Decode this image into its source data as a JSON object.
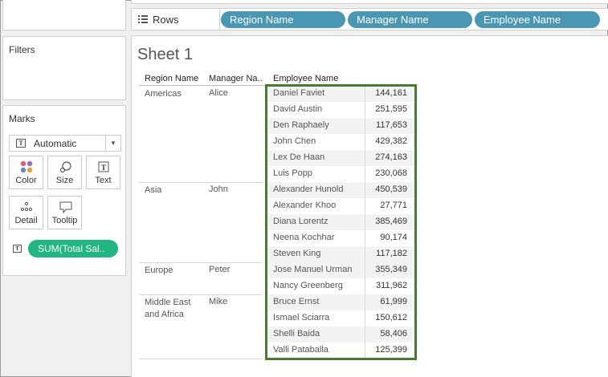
{
  "rows_shelf": {
    "label": "Rows",
    "pills": [
      "Region Name",
      "Manager Name",
      "Employee Name"
    ]
  },
  "filters": {
    "title": "Filters"
  },
  "marks": {
    "title": "Marks",
    "mark_type": "Automatic",
    "buttons": {
      "color": "Color",
      "size": "Size",
      "text": "Text",
      "detail": "Detail",
      "tooltip": "Tooltip"
    },
    "measure_pill": "SUM(Total Sal.."
  },
  "sheet": {
    "title": "Sheet 1",
    "headers": {
      "region": "Region Name",
      "manager": "Manager Na..",
      "employee": "Employee Name"
    },
    "groups": [
      {
        "region": "Americas",
        "manager": "Alice",
        "employees": [
          {
            "name": "Daniel Faviet",
            "value": "144,161"
          },
          {
            "name": "David Austin",
            "value": "251,595"
          },
          {
            "name": "Den Raphaely",
            "value": "117,653"
          },
          {
            "name": "John Chen",
            "value": "429,382"
          },
          {
            "name": "Lex De Haan",
            "value": "274,163"
          },
          {
            "name": "Luis Popp",
            "value": "230,068"
          }
        ]
      },
      {
        "region": "Asia",
        "manager": "John",
        "employees": [
          {
            "name": "Alexander Hunold",
            "value": "450,539"
          },
          {
            "name": "Alexander Khoo",
            "value": "27,771"
          },
          {
            "name": "Diana Lorentz",
            "value": "385,469"
          },
          {
            "name": "Neena Kochhar",
            "value": "90,174"
          },
          {
            "name": "Steven King",
            "value": "117,182"
          }
        ]
      },
      {
        "region": "Europe",
        "manager": "Peter",
        "employees": [
          {
            "name": "Jose Manuel Urman",
            "value": "355,349"
          },
          {
            "name": "Nancy Greenberg",
            "value": "311,962"
          }
        ]
      },
      {
        "region": "Middle East and Africa",
        "manager": "Mike",
        "employees": [
          {
            "name": "Bruce Ernst",
            "value": "61,999"
          },
          {
            "name": "Ismael Sciarra",
            "value": "150,612"
          },
          {
            "name": "Shelli Baida",
            "value": "58,406"
          },
          {
            "name": "Valli Pataballa",
            "value": "125,399"
          }
        ]
      }
    ]
  },
  "colors": {
    "dimension_pill": "#4a97b4",
    "measure_pill": "#1fb681",
    "highlight_border": "#497a31"
  }
}
